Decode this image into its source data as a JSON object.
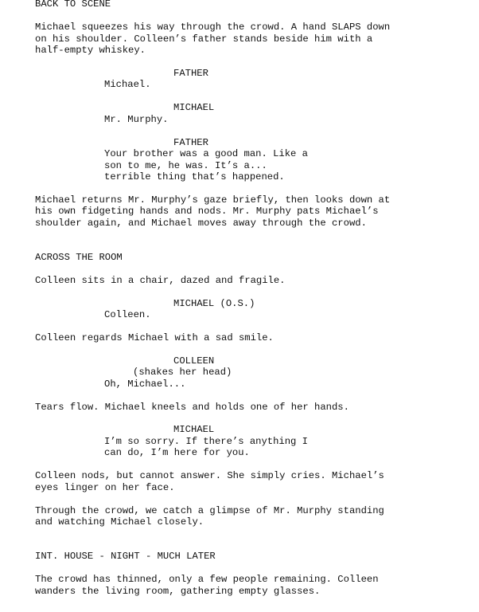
{
  "script": {
    "lines": [
      {
        "type": "action",
        "text": "BACK TO SCENE"
      },
      {
        "type": "action",
        "text": "Michael squeezes his way through the crowd. A hand SLAPS down"
      },
      {
        "type": "action",
        "text": "on his shoulder. Colleen’s father stands beside him with a"
      },
      {
        "type": "action",
        "text": "half-empty whiskey."
      },
      {
        "type": "cue",
        "text": "FATHER"
      },
      {
        "type": "dlg",
        "text": "Michael."
      },
      {
        "type": "cue",
        "text": "MICHAEL"
      },
      {
        "type": "dlg",
        "text": "Mr. Murphy."
      },
      {
        "type": "cue",
        "text": "FATHER"
      },
      {
        "type": "dlg",
        "text": "Your brother was a good man. Like a"
      },
      {
        "type": "dlg",
        "text": "son to me, he was. It’s a..."
      },
      {
        "type": "dlg",
        "text": "terrible thing that’s happened."
      },
      {
        "type": "action",
        "text": "Michael returns Mr. Murphy’s gaze briefly, then looks down at"
      },
      {
        "type": "action",
        "text": "his own fidgeting hands and nods. Mr. Murphy pats Michael’s"
      },
      {
        "type": "action",
        "text": "shoulder again, and Michael moves away through the crowd."
      },
      {
        "type": "action",
        "text": "ACROSS THE ROOM"
      },
      {
        "type": "action",
        "text": "Colleen sits in a chair, dazed and fragile."
      },
      {
        "type": "cue",
        "text": "MICHAEL (O.S.)"
      },
      {
        "type": "dlg",
        "text": "Colleen."
      },
      {
        "type": "action",
        "text": "Colleen regards Michael with a sad smile."
      },
      {
        "type": "cue",
        "text": "COLLEEN"
      },
      {
        "type": "paren",
        "text": "(shakes her head)"
      },
      {
        "type": "dlg",
        "text": "Oh, Michael..."
      },
      {
        "type": "action",
        "text": "Tears flow. Michael kneels and holds one of her hands."
      },
      {
        "type": "cue",
        "text": "MICHAEL"
      },
      {
        "type": "dlg",
        "text": "I’m so sorry. If there’s anything I"
      },
      {
        "type": "dlg",
        "text": "can do, I’m here for you."
      },
      {
        "type": "action",
        "text": "Colleen nods, but cannot answer. She simply cries. Michael’s"
      },
      {
        "type": "action",
        "text": "eyes linger on her face."
      },
      {
        "type": "action",
        "text": "Through the crowd, we catch a glimpse of Mr. Murphy standing"
      },
      {
        "type": "action",
        "text": "and watching Michael closely."
      },
      {
        "type": "action",
        "text": "INT. HOUSE - NIGHT - MUCH LATER"
      },
      {
        "type": "action",
        "text": "The crowd has thinned, only a few people remaining. Colleen"
      },
      {
        "type": "action",
        "text": "wanders the living room, gathering empty glasses."
      }
    ]
  }
}
